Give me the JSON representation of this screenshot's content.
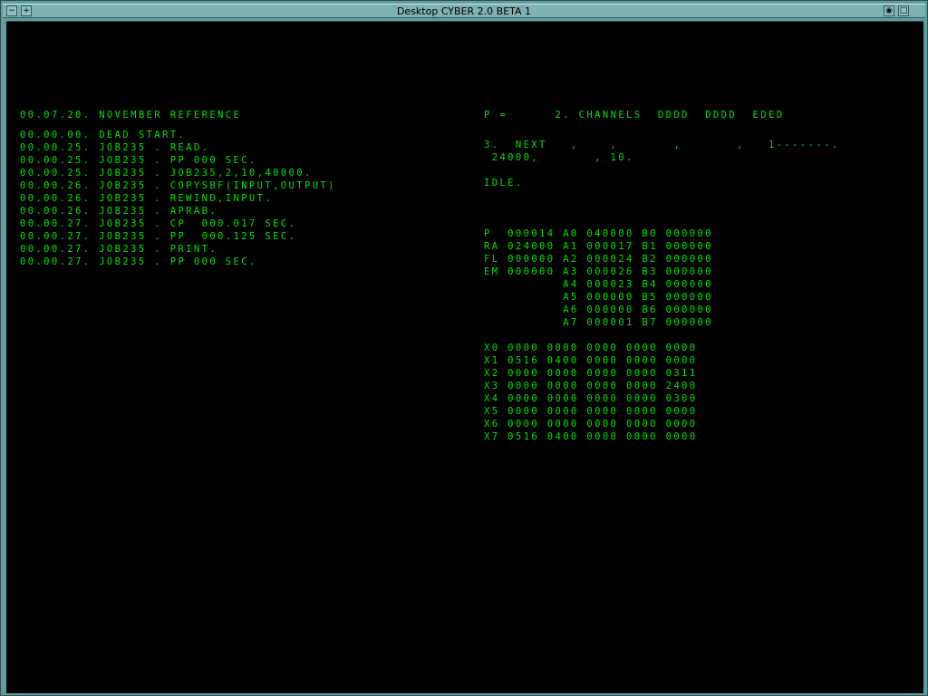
{
  "window": {
    "title": "Desktop CYBER 2.0 BETA 1",
    "minimize_glyph": "−",
    "menu_glyph": "+",
    "eye_glyph": "◉",
    "maximize_glyph": "□"
  },
  "dayfile": {
    "header": "00.07.20. NOVEMBER REFERENCE",
    "lines": [
      "00.00.00. DEAD START.",
      "00.00.25. JOB235 . READ.",
      "00.00.25. JOB235 . PP 000 SEC.",
      "00.00.25. JOB235 . JOB235,2,10,40000.",
      "00.00.26. JOB235 . COPYSBF(INPUT,OUTPUT)",
      "00.00.26. JOB235 . REWIND,INPUT.",
      "00.00.26. JOB235 . APRAB.",
      "00.00.27. JOB235 . CP  000.017 SEC.",
      "00.00.27. JOB235 . PP  000.125 SEC.",
      "00.00.27. JOB235 . PRINT.",
      "00.00.27. JOB235 . PP 000 SEC."
    ]
  },
  "status": {
    "p_line": "P =      2. CHANNELS  DDDD  DDDD  EDED",
    "next_line1": "3.  NEXT   ,    ,       ,       ,   1-------.",
    "next_line2": " 24000,       , 10.",
    "idle": "IDLE."
  },
  "registers": {
    "abp": [
      "P  000014 A0 040000 B0 000000",
      "RA 024000 A1 000017 B1 000000",
      "FL 000000 A2 000024 B2 000000",
      "EM 000000 A3 000026 B3 000000",
      "          A4 000023 B4 000000",
      "          A5 000000 B5 000000",
      "          A6 000000 B6 000000",
      "          A7 000001 B7 000000"
    ],
    "x": [
      "X0 0000 0000 0000 0000 0000",
      "X1 0516 0400 0000 0000 0000",
      "X2 0000 0000 0000 0000 0311",
      "X3 0000 0000 0000 0000 2400",
      "X4 0000 0000 0000 0000 0300",
      "X5 0000 0000 0000 0000 0000",
      "X6 0000 0000 0000 0000 0000",
      "X7 0516 0400 0000 0000 0000"
    ]
  }
}
